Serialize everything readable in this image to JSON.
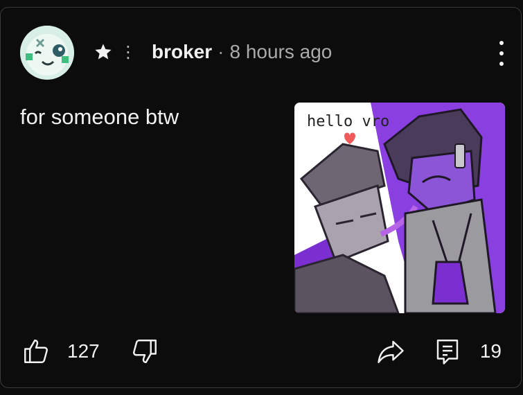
{
  "post": {
    "author": "broker",
    "separator": "·",
    "time": "8 hours ago",
    "text": "for someone btw",
    "image_caption": "hello vro",
    "likes": "127",
    "replies": "19"
  },
  "icons": {
    "badge": "star-icon",
    "menu": "kebab-menu-icon",
    "like": "thumbs-up-icon",
    "dislike": "thumbs-down-icon",
    "share": "share-arrow-icon",
    "reply": "comment-icon"
  },
  "colors": {
    "background": "#0c0c0c",
    "border": "#3a3a3a",
    "text": "#f1f1f1",
    "muted": "#aaaaaa",
    "art_purple": "#7b2fd0"
  }
}
